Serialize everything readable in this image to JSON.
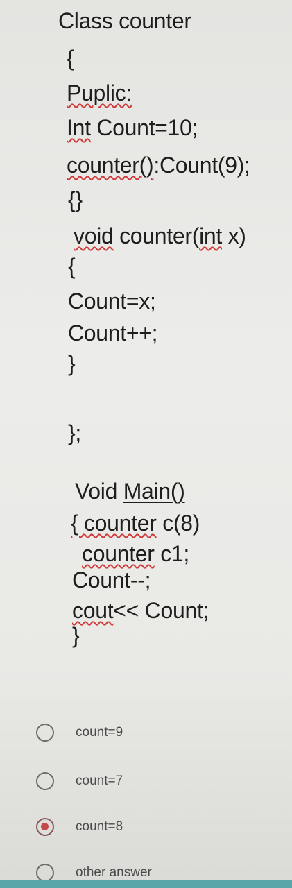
{
  "code": {
    "line1": "Class counter",
    "line2": "{",
    "line3": "Puplic:",
    "line4a": "Int",
    "line4b": " Count=10;",
    "line5a": "counter()",
    "line5b": ":Count(9);",
    "line6": "{}",
    "line7a": "void",
    "line7b": " counter(",
    "line7c": "int",
    "line7d": " x)",
    "line8": "{",
    "line9": "Count=x;",
    "line10": "Count++;",
    "line11": "}",
    "line12": "};",
    "line13a": "Void ",
    "line13b": "Main()",
    "line14a": "{ counter",
    "line14b": " c(8)",
    "line15a": "counter",
    "line15b": " c1;",
    "line16": "Count--;",
    "line17a": "cout",
    "line17b": "<< Count;",
    "line18": "}"
  },
  "options": [
    {
      "label": "count=9",
      "selected": false
    },
    {
      "label": "count=7",
      "selected": false
    },
    {
      "label": "count=8",
      "selected": true
    },
    {
      "label": "other answer",
      "selected": false
    }
  ],
  "colors": {
    "background": "#ececea",
    "text": "#1e1e1e",
    "spell_squiggle": "#d03a3a",
    "radio_selected": "#c44a4a",
    "bottom_bar": "#5aa6a8"
  }
}
